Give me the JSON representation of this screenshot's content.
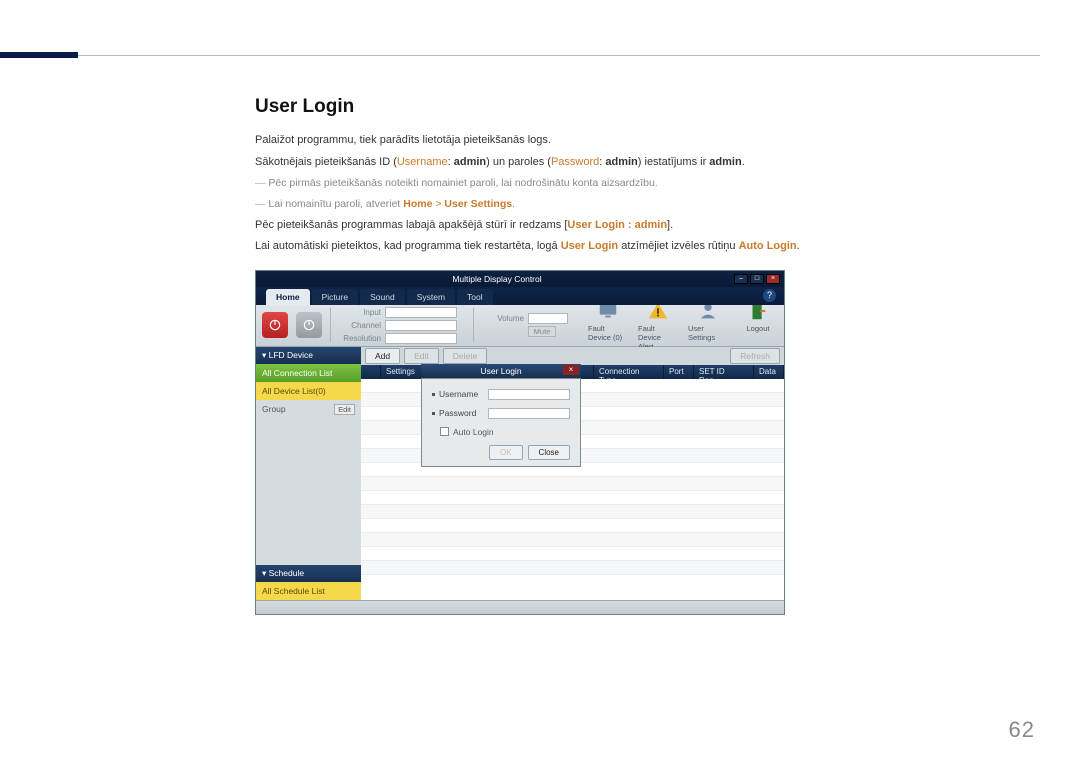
{
  "page_number": "62",
  "section_title": "User Login",
  "paragraphs": {
    "p1": "Palaižot programmu, tiek parādīts lietotāja pieteikšanās logs.",
    "p2_a": "Sākotnējais pieteikšanās ID (",
    "p2_user_lbl": "Username",
    "p2_b": ": ",
    "p2_user_val": "admin",
    "p2_c": ") un paroles (",
    "p2_pass_lbl": "Password",
    "p2_d": ": ",
    "p2_pass_val": "admin",
    "p2_e": ") iestatījums ir ",
    "p2_admin": "admin",
    "p2_f": ".",
    "note1": "Pēc pirmās pieteikšanās noteikti nomainiet paroli, lai nodrošinātu konta aizsardzību.",
    "note2_a": "Lai nomainītu paroli, atveriet ",
    "note2_home": "Home",
    "note2_gt": " > ",
    "note2_us": "User Settings",
    "note2_b": ".",
    "p3_a": "Pēc pieteikšanās programmas labajā apakšējā stūrī ir redzams [",
    "p3_b": "User Login : admin",
    "p3_c": "].",
    "p4_a": "Lai automātiski pieteiktos, kad programma tiek restartēta, logā ",
    "p4_b": "User Login",
    "p4_c": " atzīmējiet izvēles rūtiņu ",
    "p4_d": "Auto Login",
    "p4_e": "."
  },
  "app": {
    "title": "Multiple Display Control",
    "tabs": [
      "Home",
      "Picture",
      "Sound",
      "System",
      "Tool"
    ],
    "toolbar": {
      "input": "Input",
      "channel": "Channel",
      "resolution": "Resolution",
      "volume": "Volume",
      "mute": "Mute"
    },
    "actions": {
      "fault_device": "Fault Device (0)",
      "fault_alert": "Fault Device Alert",
      "user_settings": "User Settings",
      "logout": "Logout"
    },
    "sidebar": {
      "lfd_header": "▾  LFD Device",
      "all_conn": "All Connection List",
      "all_dev": "All Device List(0)",
      "group": "Group",
      "edit": "Edit",
      "sched_header": "▾  Schedule",
      "all_sched": "All Schedule List"
    },
    "content_bar": {
      "add": "Add",
      "edit": "Edit",
      "delete": "Delete",
      "refresh": "Refresh"
    },
    "grid_cols": [
      "",
      "Settings",
      "",
      "Connection Type",
      "Port",
      "SET ID Ran...",
      "Data"
    ],
    "modal": {
      "title": "User Login",
      "username": "Username",
      "password": "Password",
      "auto": "Auto Login",
      "ok": "OK",
      "close": "Close"
    }
  }
}
